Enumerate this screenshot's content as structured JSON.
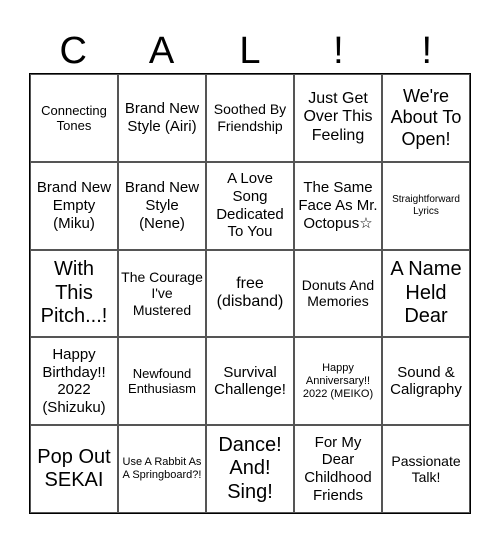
{
  "header": {
    "letters": [
      "C",
      "A",
      "L",
      "!",
      "!"
    ]
  },
  "board": {
    "cells": [
      [
        "Connecting Tones",
        "Brand New Style (Airi)",
        "Soothed By Friendship",
        "Just Get Over This Feeling",
        "We're About To Open!"
      ],
      [
        "Brand New Empty (Miku)",
        "Brand New Style (Nene)",
        "A Love Song Dedicated To You",
        "The Same Face As Mr. Octopus☆",
        "Straightforward Lyrics"
      ],
      [
        "With This Pitch...!",
        "The Courage I've Mustered",
        "free (disband)",
        "Donuts And Memories",
        "A Name Held Dear"
      ],
      [
        "Happy Birthday!! 2022 (Shizuku)",
        "Newfound Enthusiasm",
        "Survival Challenge!",
        "Happy Anniversary!! 2022 (MEIKO)",
        "Sound & Caligraphy"
      ],
      [
        "Pop Out SEKAI",
        "Use A Rabbit As A Springboard?!",
        "Dance! And! Sing!",
        "For My Dear Childhood Friends",
        "Passionate Talk!"
      ]
    ]
  }
}
